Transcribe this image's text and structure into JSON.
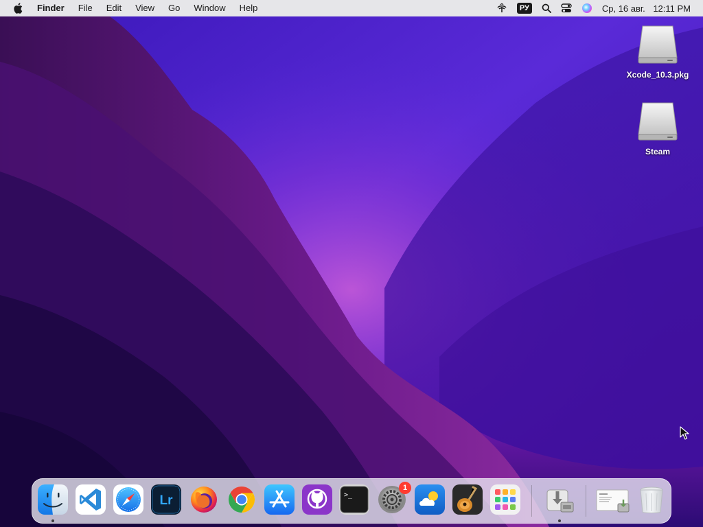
{
  "menubar": {
    "app_name": "Finder",
    "items": [
      "File",
      "Edit",
      "View",
      "Go",
      "Window",
      "Help"
    ],
    "language": "РУ",
    "date": "Ср, 16 авг.",
    "time": "12:11 PM"
  },
  "desktop": {
    "icons": [
      {
        "label": "Xcode_10.3.pkg",
        "icon": "disk-image-icon"
      },
      {
        "label": "Steam",
        "icon": "disk-image-icon"
      }
    ]
  },
  "dock": {
    "apps": [
      {
        "name": "Finder",
        "icon": "finder-icon",
        "running": true
      },
      {
        "name": "Visual Studio Code",
        "icon": "vscode-icon",
        "running": false
      },
      {
        "name": "Safari",
        "icon": "safari-icon",
        "running": false
      },
      {
        "name": "Lightroom",
        "icon": "lightroom-icon",
        "running": false,
        "text": "Lr"
      },
      {
        "name": "Firefox",
        "icon": "firefox-icon",
        "running": false
      },
      {
        "name": "Google Chrome",
        "icon": "chrome-icon",
        "running": false
      },
      {
        "name": "App Store",
        "icon": "app-store-icon",
        "running": false
      },
      {
        "name": "GitHub Desktop",
        "icon": "github-icon",
        "running": false
      },
      {
        "name": "Terminal",
        "icon": "terminal-icon",
        "running": false,
        "text": ">_"
      },
      {
        "name": "System Preferences",
        "icon": "system-preferences-icon",
        "running": false,
        "badge": "1"
      },
      {
        "name": "Weather",
        "icon": "weather-icon",
        "running": false
      },
      {
        "name": "GarageBand",
        "icon": "garageband-icon",
        "running": false
      },
      {
        "name": "Launchpad",
        "icon": "launchpad-icon",
        "running": false
      },
      {
        "name": "Installer",
        "icon": "installer-icon",
        "running": true
      },
      {
        "name": "Downloads",
        "icon": "downloads-stack-icon",
        "running": false
      },
      {
        "name": "Trash",
        "icon": "trash-icon",
        "running": false
      }
    ]
  },
  "colors": {
    "menubar_bg": "#e6e6e9",
    "wallpaper_deep": "#1b0a4a",
    "wallpaper_violet": "#6b1fc4",
    "wallpaper_magenta": "#a21f8e",
    "badge_red": "#ff3b30"
  }
}
